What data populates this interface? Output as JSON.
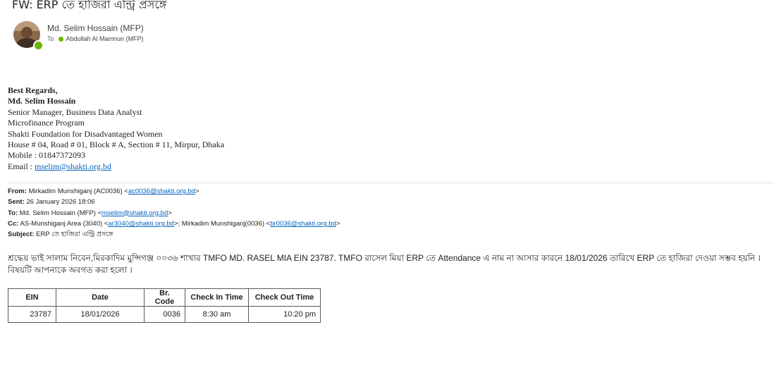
{
  "email": {
    "subject": "FW: ERP তে হাজিরা এন্ট্রি প্রসঙ্গে",
    "sender": "Md. Selim Hossain (MFP)",
    "to_label": "To",
    "recipient": "Abdullah Al Mamnun (MFP)"
  },
  "signature": {
    "regards": "Best Regards,",
    "name": "Md. Selim Hossain",
    "title": "Senior Manager, Business Data Analyst",
    "program": "Microfinance  Program",
    "org": "Shakti Foundation for Disadvantaged Women",
    "address": "House # 04, Road # 01, Block # A, Section # 11, Mirpur, Dhaka",
    "mobile": "Mobile : 01847372093",
    "email_label": "Email : ",
    "email": "mselim@shakti.org.bd"
  },
  "forward_header": {
    "from_label": "From:",
    "from_name": "Mirkadim Munshiganj (AC0036) <",
    "from_email": "ac0036@shakti.org.bd",
    "from_tail": ">",
    "sent_label": "Sent:",
    "sent_value": "26 January 2026 18:06",
    "to_label": "To:",
    "to_name": "Md. Selim Hossain (MFP) <",
    "to_email": "mselim@shakti.org.bd",
    "to_tail": ">",
    "cc_label": "Cc:",
    "cc_name1": "AS-Munshiganj Area (3040) <",
    "cc_email1": "ar3040@shakti.org.bd",
    "cc_mid": ">; Mirkadim Munshiganj(0036) <",
    "cc_email2": "br0036@shakti.org.bd",
    "cc_tail": ">",
    "subject_label": "Subject:",
    "subject_value": "ERP তে হাজিরা এন্ট্রি প্রসঙ্গে"
  },
  "body": {
    "paragraph": "শ্রদ্ধেয় ভাই সালাম নিবেন,মিরকাদিম মুন্সিগঞ্জ ০০৩৬ শাখার TMFO  MD. RASEL MIA EIN 23787. TMFO রাসেল মিয়া ERP তে Attendance এ নাম না আসার কারনে 18/01/2026 তারিখে ERP তে হাজিরা দেওয়া সম্ভব হয়নি । বিষয়টি আপনাকে অবগত করা হলো ।"
  },
  "attendance_table": {
    "headers": [
      "EIN",
      "Date",
      "Br. Code",
      "Check In Time",
      "Check Out Time"
    ],
    "rows": [
      [
        "23787",
        "18/01/2026",
        "0036",
        "8:30 am",
        "10:20 pm"
      ]
    ]
  }
}
